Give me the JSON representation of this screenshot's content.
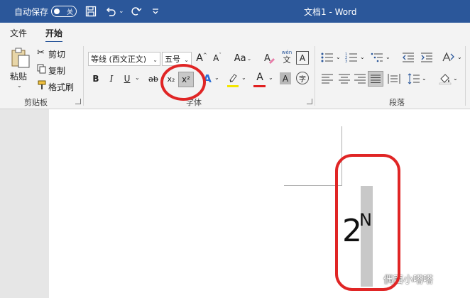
{
  "titlebar": {
    "autosave_label": "自动保存",
    "autosave_state": "关",
    "document_title": "文档1  -  Word",
    "bg_color": "#2b579a"
  },
  "tabs": [
    {
      "label": "文件",
      "active": false
    },
    {
      "label": "开始",
      "active": true
    }
  ],
  "clipboard": {
    "paste_label": "粘贴",
    "cut_label": "剪切",
    "copy_label": "复制",
    "format_painter_label": "格式刷",
    "group_label": "剪贴板"
  },
  "font": {
    "font_name": "等线 (西文正文)",
    "font_size": "五号",
    "grow_label": "A",
    "shrink_label": "A",
    "case_label": "Aa",
    "phonetic_top": "wén",
    "phonetic_bottom": "文",
    "border_label": "A",
    "bold": "B",
    "italic": "I",
    "underline": "U",
    "strikethrough": "ab",
    "subscript": "x₂",
    "superscript": "x²",
    "effects_label": "A",
    "font_color_label": "A",
    "shading_label": "A",
    "enclose_label": "字",
    "group_label": "字体",
    "group_label_hidden": "字"
  },
  "paragraph": {
    "group_label": "段落"
  },
  "document": {
    "base_text": "2",
    "superscript_text": "N",
    "watermark": "偶西小嗒嗒"
  },
  "colors": {
    "annotation": "#e02525",
    "font_color": "#e02020",
    "highlight": "#f3e600"
  }
}
